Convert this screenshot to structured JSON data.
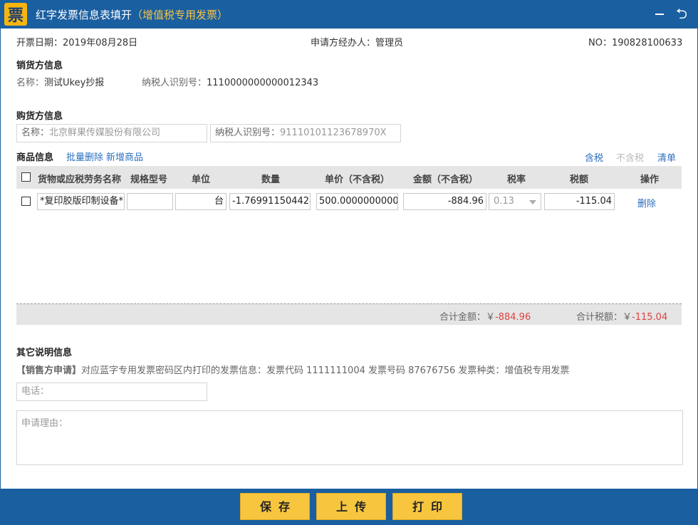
{
  "window": {
    "logo_char": "票",
    "title": "红字发票信息表填开",
    "subtitle": "（增值税专用发票）",
    "back_glyph": "⮌"
  },
  "header": {
    "date_label": "开票日期：",
    "date_value": "2019年08月28日",
    "agent_label": "申请方经办人：",
    "agent_value": "管理员",
    "no_label": "NO：",
    "no_value": "190828100633"
  },
  "seller": {
    "section_title": "销货方信息",
    "name_label": "名称：",
    "name_value": "测试Ukey抄报",
    "tax_label": "纳税人识别号：",
    "tax_value": "1110000000000012343"
  },
  "buyer": {
    "section_title": "购货方信息",
    "name_label": "名称：",
    "name_value": "北京鲜果传媒股份有限公司",
    "tax_label": "纳税人识别号：",
    "tax_value": "91110101123678970X"
  },
  "goods": {
    "section_title": "商品信息",
    "batch_delete": "批量删除",
    "add_item": "新增商品",
    "tax_incl": "含税",
    "tax_excl": "不含税",
    "list_label": "清单",
    "columns": [
      "货物或应税劳务名称",
      "规格型号",
      "单位",
      "数量",
      "单价（不含税）",
      "金额（不含税）",
      "税率",
      "税额",
      "操作"
    ],
    "rows": [
      {
        "name": "*复印胶版印制设备*",
        "spec": "",
        "unit": "台",
        "quantity": "-1.769911504424",
        "price": "500.000000000000",
        "amount": "-884.96",
        "rate": "0.13",
        "tax": "-115.04",
        "action": "删除"
      }
    ],
    "total_amount_label": "合计金额：",
    "total_amount": "-884.96",
    "total_tax_label": "合计税额：",
    "total_tax": "-115.04",
    "currency": "￥"
  },
  "other": {
    "section_title": "其它说明信息",
    "note_tag": "【销售方申请】",
    "note_text": "对应蓝字专用发票密码区内打印的发票信息：发票代码 1111111004 发票号码 87676756 发票种类：增值税专用发票",
    "phone_placeholder": "电话：",
    "reason_placeholder": "申请理由："
  },
  "footer": {
    "save": "保存",
    "upload": "上传",
    "print": "打印"
  },
  "colors": {
    "primary": "#1a5fa0",
    "accent": "#f7c63e",
    "negative": "#e04040",
    "link": "#2b6fc0"
  }
}
